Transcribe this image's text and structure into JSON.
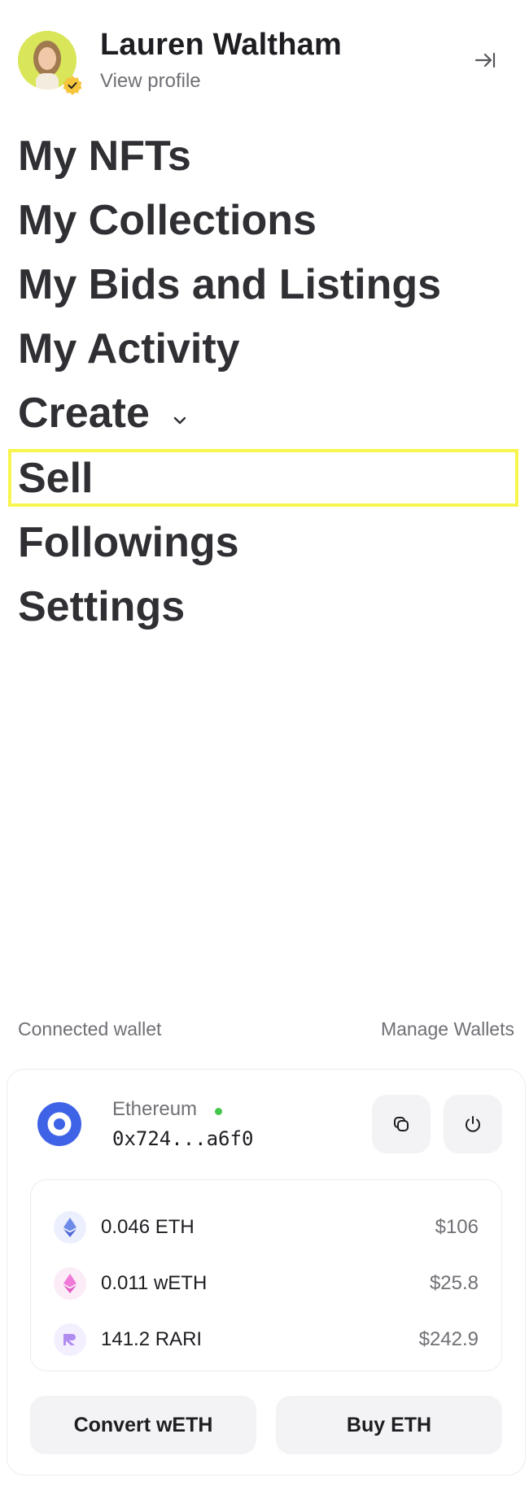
{
  "profile": {
    "name": "Lauren Waltham",
    "view_profile_label": "View profile"
  },
  "nav": {
    "items": [
      {
        "label": "My NFTs"
      },
      {
        "label": "My Collections"
      },
      {
        "label": "My Bids and Listings"
      },
      {
        "label": "My Activity"
      },
      {
        "label": "Create",
        "has_dropdown": true
      },
      {
        "label": "Sell",
        "highlighted": true
      },
      {
        "label": "Followings"
      },
      {
        "label": "Settings"
      }
    ]
  },
  "wallet": {
    "section_label": "Connected wallet",
    "manage_label": "Manage Wallets",
    "chain": "Ethereum",
    "status": "connected",
    "address": "0x724...a6f0",
    "balances": [
      {
        "amount": "0.046 ETH",
        "usd": "$106",
        "icon": "eth-icon"
      },
      {
        "amount": "0.011 wETH",
        "usd": "$25.8",
        "icon": "weth-icon"
      },
      {
        "amount": "141.2 RARI",
        "usd": "$242.9",
        "icon": "rari-icon"
      }
    ],
    "convert_label": "Convert wETH",
    "buy_label": "Buy ETH"
  },
  "colors": {
    "highlight": "#f7f54e",
    "status_online": "#45c64b",
    "chain_blue": "#3f63e6",
    "avatar_bg": "#d9e65a",
    "badge": "#f6c53b"
  }
}
